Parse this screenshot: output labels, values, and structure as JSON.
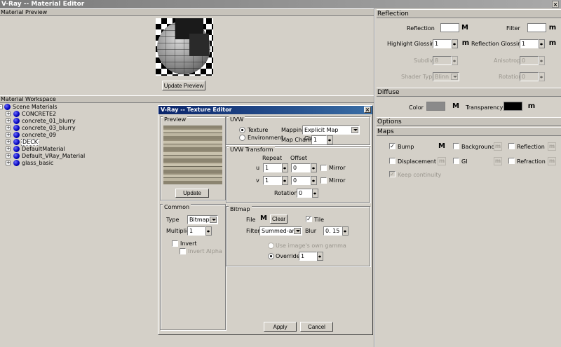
{
  "window": {
    "title": "V-Ray -- Material Editor",
    "close_glyph": "×"
  },
  "preview_section": {
    "title": "Material Preview",
    "update_label": "Update Preview"
  },
  "workspace": {
    "title": "Material Workspace",
    "root": "Scene Materials",
    "items": [
      "CONCRETE2",
      "concrete_01_blurry",
      "concrete_03_blurry",
      "concrete_09",
      "DECK",
      "DefaultMaterial",
      "Default_VRay_Material",
      "glass_basic"
    ]
  },
  "texture_editor": {
    "title": "V-Ray -- Texture Editor",
    "close_glyph": "×",
    "preview": {
      "title": "Preview",
      "update_label": "Update"
    },
    "uvw": {
      "title": "UVW",
      "texture_label": "Texture",
      "environment_label": "Environment",
      "mapping_label": "Mapping",
      "mapping_value": "Explicit Map Channel",
      "map_channel_label": "Map Channel",
      "map_channel_value": "1"
    },
    "uvw_transform": {
      "title": "UVW Transform",
      "repeat_label": "Repeat",
      "offset_label": "Offset",
      "u_label": "u",
      "v_label": "v",
      "u_repeat": "1",
      "u_offset": "0",
      "v_repeat": "1",
      "v_offset": "0",
      "mirror_label": "Mirror",
      "rotation_label": "Rotation",
      "rotation_value": "0"
    },
    "common": {
      "title": "Common",
      "type_label": "Type",
      "type_value": "Bitmap",
      "multiplier_label": "Multiplier",
      "multiplier_value": "1",
      "invert_label": "Invert",
      "invert_alpha_label": "Invert Alpha"
    },
    "bitmap": {
      "title": "Bitmap",
      "file_label": "File",
      "file_button": "M",
      "clear_label": "Clear",
      "tile_label": "Tile",
      "filter_label": "Filter",
      "filter_value": "Summed-area",
      "blur_label": "Blur",
      "blur_value": "0. 15",
      "gamma_label": "Use image's own gamma",
      "override_label": "Override",
      "override_value": "1"
    },
    "apply_label": "Apply",
    "cancel_label": "Cancel"
  },
  "reflection": {
    "title": "Reflection",
    "reflection_label": "Reflection",
    "filter_label": "Filter",
    "m_label": "M",
    "m_small": "m",
    "highlight_label": "Highlight Glossiness",
    "highlight_value": "1",
    "refl_gloss_label": "Reflection Glossiness",
    "refl_gloss_value": "1",
    "subdivs_label": "Subdivs",
    "subdivs_value": "8",
    "anisotropy_label": "Anisotropy",
    "anisotropy_value": "0",
    "shader_label": "Shader Type",
    "shader_value": "Blinn",
    "rotation_label": "Rotation",
    "rotation_value": "0"
  },
  "diffuse": {
    "title": "Diffuse",
    "color_label": "Color",
    "m_label": "M",
    "transparency_label": "Transparency",
    "m_small": "m",
    "color_hex": "#8a8a8a",
    "transparency_hex": "#000000"
  },
  "options": {
    "title": "Options"
  },
  "maps": {
    "title": "Maps",
    "bump_label": "Bump",
    "bump_m": "M",
    "background_label": "Background",
    "reflection_label": "Reflection",
    "displacement_label": "Displacement",
    "gi_label": "GI",
    "refraction_label": "Refraction",
    "keep_label": "Keep continuity",
    "m_small": "m"
  }
}
